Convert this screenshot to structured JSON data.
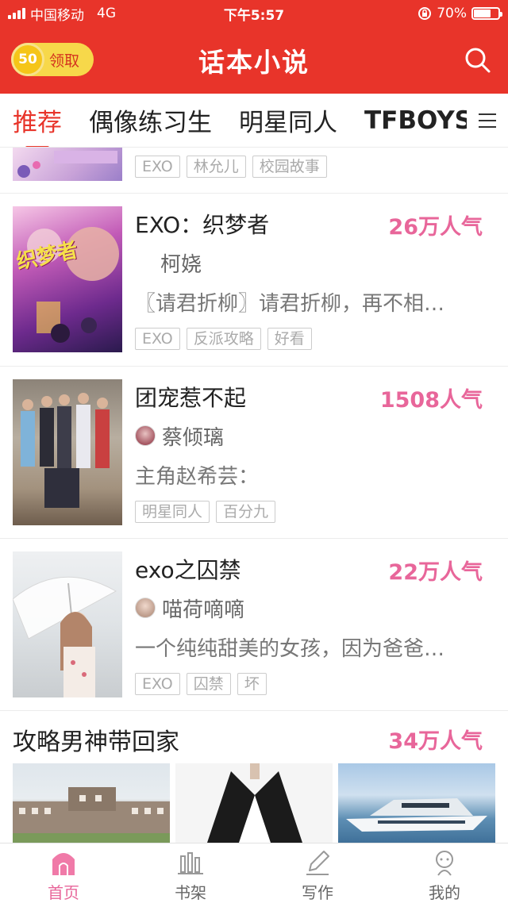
{
  "status_bar": {
    "carrier": "中国移动",
    "network": "4G",
    "time": "下午5:57",
    "battery": "70%",
    "battery_level": 0.7
  },
  "header": {
    "title": "话本小说",
    "coin_value": "50",
    "claim_label": "领取"
  },
  "tabs": [
    {
      "label": "推荐",
      "active": true
    },
    {
      "label": "偶像练习生"
    },
    {
      "label": "明星同人"
    },
    {
      "label": "TFBOYS"
    }
  ],
  "feed": {
    "partial_tags": [
      "EXO",
      "林允儿",
      "校园故事"
    ],
    "items": [
      {
        "title": "EXO：织梦者",
        "hot": "26万人气",
        "author": "柯娆",
        "desc": "〖请君折柳〗请君折柳，再不相…",
        "tags": [
          "EXO",
          "反派攻略",
          "好看"
        ],
        "cover_text": "织梦者"
      },
      {
        "title": "团宠惹不起",
        "hot": "1508人气",
        "author": "蔡倾璃",
        "desc": "主角赵希芸：",
        "tags": [
          "明星同人",
          "百分九"
        ]
      },
      {
        "title": "exo之囚禁",
        "hot": "22万人气",
        "author": "喵荷嘀嘀",
        "desc": "一个纯纯甜美的女孩，因为爸爸…",
        "tags": [
          "EXO",
          "囚禁",
          "坏"
        ]
      }
    ],
    "section": {
      "title": "攻略男神带回家",
      "hot": "34万人气"
    }
  },
  "bottom_nav": [
    {
      "label": "首页",
      "icon": "home-icon",
      "active": true
    },
    {
      "label": "书架",
      "icon": "bookshelf-icon"
    },
    {
      "label": "写作",
      "icon": "pen-icon"
    },
    {
      "label": "我的",
      "icon": "profile-icon"
    }
  ],
  "colors": {
    "brand_red": "#e8342a",
    "hot_pink": "#e8669a",
    "coin_yellow": "#f7d84a"
  }
}
